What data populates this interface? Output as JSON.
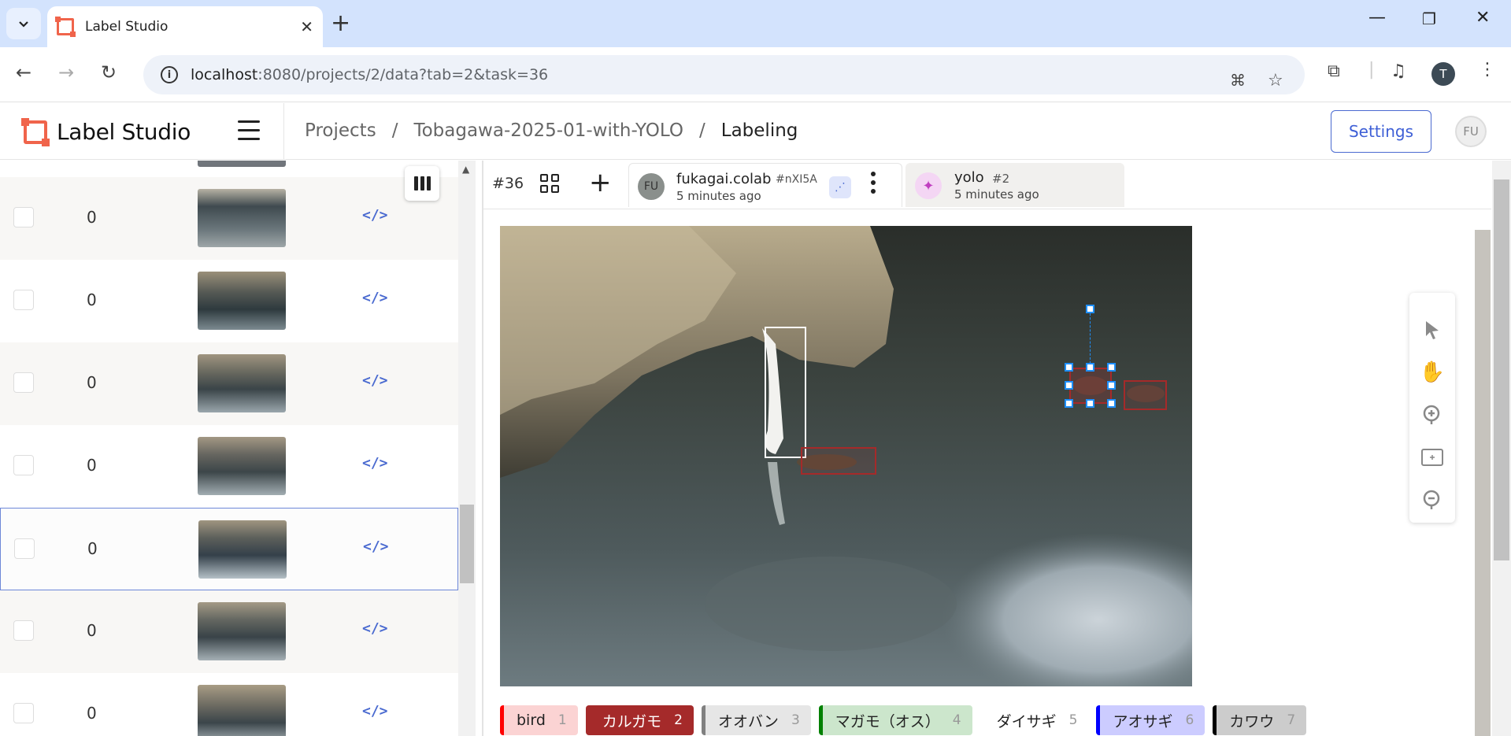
{
  "browser": {
    "tab_title": "Label Studio",
    "url_host": "localhost",
    "url_path": ":8080/projects/2/data?tab=2&task=36",
    "profile_initial": "T"
  },
  "app": {
    "logo_text": "Label Studio",
    "breadcrumb": [
      "Projects",
      "Tobagawa-2025-01-with-YOLO",
      "Labeling"
    ],
    "breadcrumb_sep": "/",
    "settings_label": "Settings",
    "user_initials": "FU"
  },
  "task_list": {
    "rows": [
      {
        "count": "0",
        "code": "</>"
      },
      {
        "count": "0",
        "code": "</>"
      },
      {
        "count": "0",
        "code": "</>"
      },
      {
        "count": "0",
        "code": "</>"
      },
      {
        "count": "0",
        "code": "</>"
      },
      {
        "count": "0",
        "code": "</>"
      },
      {
        "count": "0",
        "code": "</>"
      }
    ]
  },
  "labeling": {
    "task_id": "#36",
    "annotation": {
      "avatar": "FU",
      "user": "fukagai.colab",
      "id": "#nXI5A",
      "time": "5 minutes ago"
    },
    "prediction": {
      "model": "yolo",
      "id": "#2",
      "time": "5 minutes ago"
    }
  },
  "labels": [
    {
      "name": "bird",
      "hotkey": "1",
      "color": "#ff0000",
      "bg": "#fbd3d3"
    },
    {
      "name": "カルガモ",
      "hotkey": "2",
      "color": "#a52a2a",
      "bg": "#a52a2a"
    },
    {
      "name": "オオバン",
      "hotkey": "3",
      "color": "#808080",
      "bg": "#e6e6e6"
    },
    {
      "name": "マガモ（オス）",
      "hotkey": "4",
      "color": "#008000",
      "bg": "#cce6cc"
    },
    {
      "name": "ダイサギ",
      "hotkey": "5",
      "color": "#ffffff",
      "bg": "#ffffff"
    },
    {
      "name": "アオサギ",
      "hotkey": "6",
      "color": "#0000ff",
      "bg": "#ccccff"
    },
    {
      "name": "カワウ",
      "hotkey": "7",
      "color": "#000000",
      "bg": "#cccccc"
    }
  ]
}
